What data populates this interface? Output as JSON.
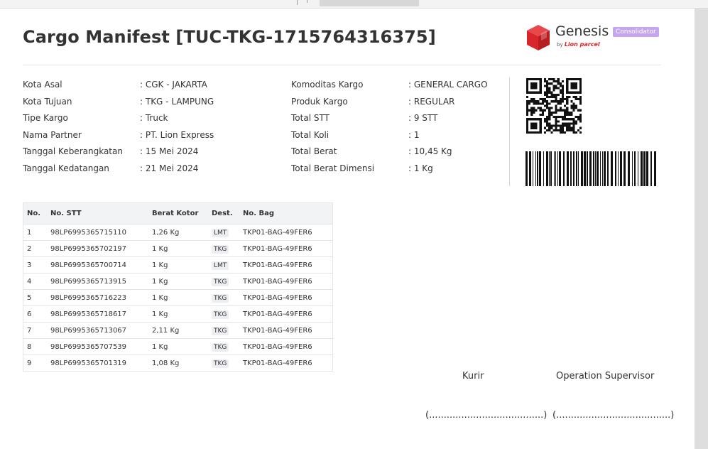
{
  "document": {
    "title": "Cargo Manifest [TUC-TKG-1715764316375]",
    "brand": {
      "name": "Genesis",
      "by": "by",
      "partner": "Lion parcel",
      "badge": "Consolidator",
      "colors": {
        "logo_red": "#d9262c",
        "badge_bg": "#c6a5ef"
      }
    },
    "details_left": [
      {
        "label": "Kota Asal",
        "value": ": CGK - JAKARTA"
      },
      {
        "label": "Kota Tujuan",
        "value": ": TKG - LAMPUNG"
      },
      {
        "label": "Tipe Kargo",
        "value": ": Truck"
      },
      {
        "label": "Nama Partner",
        "value": ": PT. Lion Express"
      },
      {
        "label": "Tanggal Keberangkatan",
        "value": ": 15 Mei 2024"
      },
      {
        "label": "Tanggal Kedatangan",
        "value": ": 21 Mei 2024"
      }
    ],
    "details_right": [
      {
        "label": "Komoditas Kargo",
        "value": ": GENERAL CARGO"
      },
      {
        "label": "Produk Kargo",
        "value": ": REGULAR"
      },
      {
        "label": "Total STT",
        "value": ": 9 STT"
      },
      {
        "label": "Total Koli",
        "value": ": 1"
      },
      {
        "label": "Total Berat",
        "value": ": 10,45 Kg"
      },
      {
        "label": "Total Berat Dimensi",
        "value": ": 1 Kg"
      }
    ],
    "table": {
      "headers": [
        "No.",
        "No. STT",
        "Berat Kotor",
        "Dest.",
        "No. Bag"
      ],
      "rows": [
        [
          "1",
          "98LP6995365715110",
          "1,26 Kg",
          "LMT",
          "TKP01-BAG-49FER6"
        ],
        [
          "2",
          "98LP6995365702197",
          "1 Kg",
          "TKG",
          "TKP01-BAG-49FER6"
        ],
        [
          "3",
          "98LP6995365700714",
          "1 Kg",
          "LMT",
          "TKP01-BAG-49FER6"
        ],
        [
          "4",
          "98LP6995365713915",
          "1 Kg",
          "TKG",
          "TKP01-BAG-49FER6"
        ],
        [
          "5",
          "98LP6995365716223",
          "1 Kg",
          "TKG",
          "TKP01-BAG-49FER6"
        ],
        [
          "6",
          "98LP6995365718617",
          "1 Kg",
          "TKG",
          "TKP01-BAG-49FER6"
        ],
        [
          "7",
          "98LP6995365713067",
          "2,11 Kg",
          "TKG",
          "TKP01-BAG-49FER6"
        ],
        [
          "8",
          "98LP6995365707539",
          "1 Kg",
          "TKG",
          "TKP01-BAG-49FER6"
        ],
        [
          "9",
          "98LP6995365701319",
          "1,08 Kg",
          "TKG",
          "TKP01-BAG-49FER6"
        ]
      ]
    },
    "signatures": [
      {
        "label": "Kurir",
        "line": "(.......................................)"
      },
      {
        "label": "Operation Supervisor",
        "line": "(.......................................)"
      }
    ],
    "icons": [
      "genesis-logo-icon",
      "qr-code-icon",
      "barcode-icon"
    ]
  }
}
